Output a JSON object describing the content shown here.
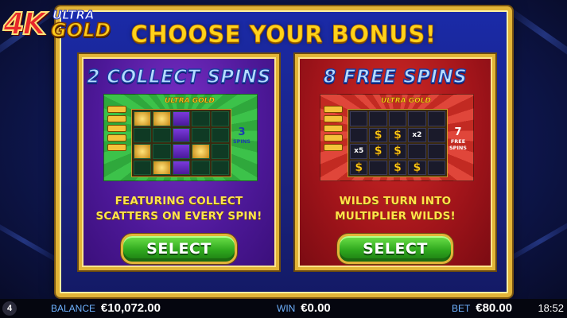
{
  "logo": {
    "part1": "4K",
    "part2": "ULTRA",
    "part3": "GOLD"
  },
  "title": "CHOOSE YOUR BONUS!",
  "bonuses": [
    {
      "title": "2 COLLECT SPINS",
      "preview_logo": "ULTRA GOLD",
      "preview_count": "3",
      "preview_count_word": "SPINS",
      "description_line1": "FEATURING COLLECT",
      "description_line2": "SCATTERS ON EVERY SPIN!",
      "button": "SELECT"
    },
    {
      "title": "8 FREE SPINS",
      "preview_logo": "ULTRA GOLD",
      "preview_count": "7",
      "preview_count_word": "FREE SPINS",
      "multiplier_a": "x2",
      "multiplier_b": "x5",
      "description_line1": "WILDS TURN INTO",
      "description_line2": "MULTIPLIER WILDS!",
      "button": "SELECT"
    }
  ],
  "status": {
    "icon": "4",
    "balance_label": "BALANCE",
    "balance_value": "€10,072.00",
    "win_label": "WIN",
    "win_value": "€0.00",
    "bet_label": "BET",
    "bet_value": "€80.00",
    "clock": "18:52"
  },
  "colors": {
    "gold": "#e2b437",
    "title_yellow": "#ffd21a",
    "collect_panel": "#4d1898",
    "free_panel": "#a0141a",
    "button_green": "#2fa81e"
  }
}
